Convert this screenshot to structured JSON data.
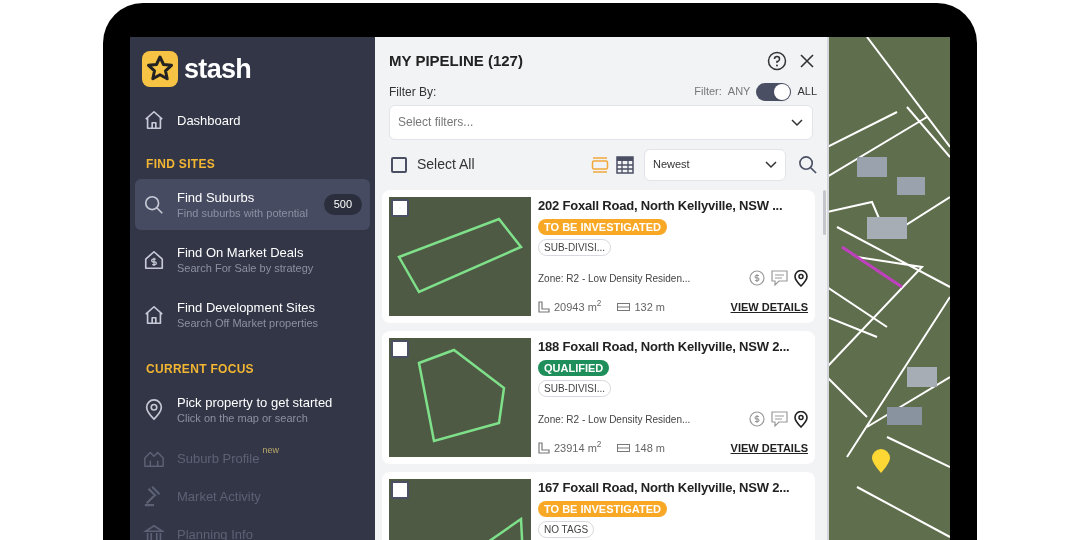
{
  "sidebar": {
    "logo": "stash",
    "items": [
      {
        "kind": "link",
        "label": "Dashboard",
        "selected": false,
        "disabled": false
      },
      {
        "kind": "heading",
        "label": "FIND SITES"
      },
      {
        "kind": "link",
        "label": "Find Suburbs",
        "subtitle": "Find suburbs with potential",
        "badge": "500",
        "selected": true,
        "disabled": false
      },
      {
        "kind": "link",
        "label": "Find On Market Deals",
        "subtitle": "Search For Sale by strategy",
        "selected": false,
        "disabled": false
      },
      {
        "kind": "link",
        "label": "Find Development Sites",
        "subtitle": "Search Off Market properties",
        "selected": false,
        "disabled": false
      },
      {
        "kind": "heading",
        "label": "CURRENT FOCUS"
      },
      {
        "kind": "link",
        "label": "Pick property to get started",
        "subtitle": "Click on the map or search",
        "selected": false,
        "disabled": false
      },
      {
        "kind": "link",
        "label": "Suburb Profile",
        "note": "new",
        "selected": false,
        "disabled": true
      },
      {
        "kind": "link",
        "label": "Market Activity",
        "selected": false,
        "disabled": true
      },
      {
        "kind": "link",
        "label": "Planning Info",
        "selected": false,
        "disabled": true
      }
    ]
  },
  "panel": {
    "title": "MY PIPELINE (127)",
    "filter_label": "Filter By:",
    "filter_toggle": {
      "label": "Filter:",
      "off_label": "ANY",
      "on_label": "ALL",
      "on": true
    },
    "filter_select": {
      "placeholder": "Select filters..."
    },
    "select_all": {
      "label": "Select All",
      "checked": false
    },
    "views": [
      {
        "kind": "cards",
        "selected": true
      },
      {
        "kind": "grid",
        "selected": false
      }
    ],
    "sort": {
      "value": "Newest"
    },
    "cards": [
      {
        "checked": false,
        "address": "202 Foxall Road, North Kellyville, NSW ...",
        "status": "TO BE INVESTIGATED",
        "color": "#f9a825",
        "tag": "SUB-DIVISI...",
        "zone": "Zone: R2 - Low Density Residen...",
        "area": "20943 m$^{2}$",
        "frontage": "132 m",
        "link": "VIEW DETAILS"
      },
      {
        "checked": false,
        "address": "188 Foxall Road, North Kellyville, NSW 2...",
        "status": "QUALIFIED",
        "color": "#1e8e5a",
        "tag": "SUB-DIVISI...",
        "zone": "Zone: R2 - Low Density Residen...",
        "area": "23914 m$^{2}$",
        "frontage": "148 m",
        "link": "VIEW DETAILS"
      },
      {
        "checked": false,
        "address": "167 Foxall Road, North Kellyville, NSW 2...",
        "status": "TO BE INVESTIGATED",
        "color": "#f9a825",
        "tag": "NO TAGS"
      }
    ]
  }
}
